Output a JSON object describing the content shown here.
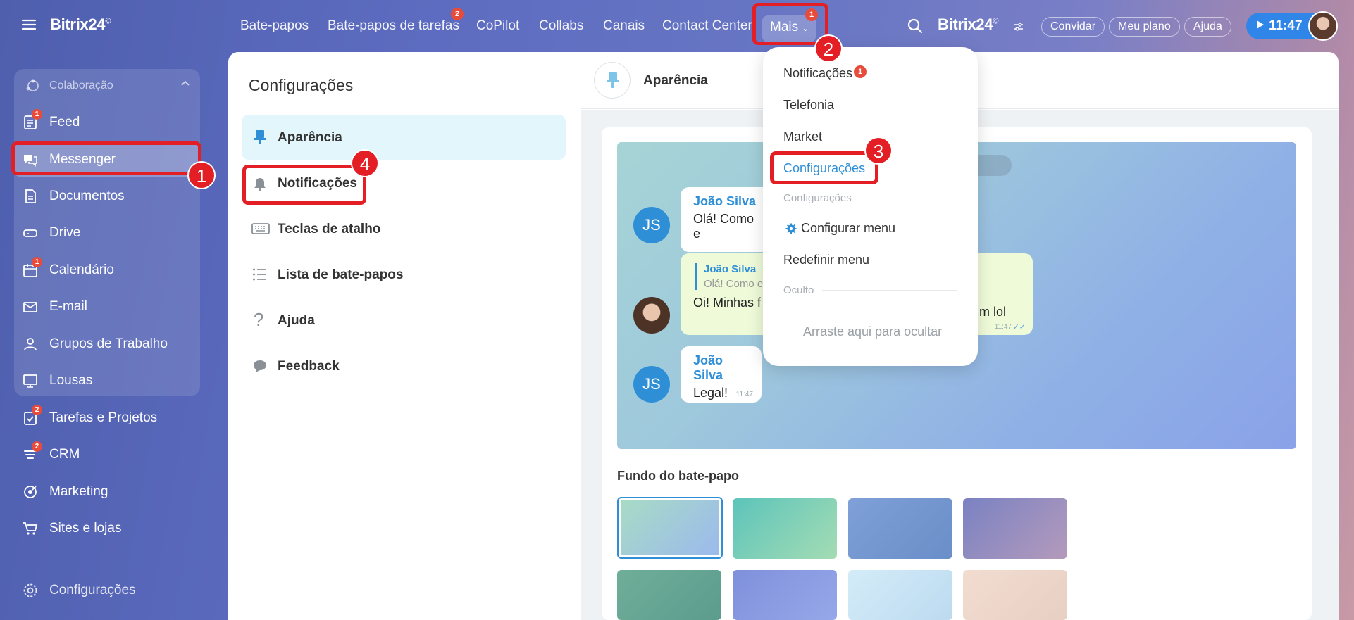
{
  "app": {
    "brand": "Bitrix24",
    "brand_mark": "©",
    "brand_right": "Bitrix24"
  },
  "topnav": {
    "links": [
      "Bate-papos",
      "Bate-papos de tarefas",
      "CoPilot",
      "Collabs",
      "Canais",
      "Contact Center"
    ],
    "tasks_badge": "2",
    "more_label": "Mais",
    "more_badge": "1",
    "invite": "Convidar",
    "plan": "Meu plano",
    "help": "Ajuda",
    "timer": "11:47"
  },
  "sidebar": {
    "group_label": "Colaboração",
    "items": [
      {
        "label": "Feed",
        "badge": "1",
        "icon": "feed-icon"
      },
      {
        "label": "Messenger",
        "badge": "",
        "icon": "messenger-icon"
      },
      {
        "label": "Documentos",
        "badge": "",
        "icon": "document-icon"
      },
      {
        "label": "Drive",
        "badge": "",
        "icon": "drive-icon"
      },
      {
        "label": "Calendário",
        "badge": "1",
        "icon": "calendar-icon"
      },
      {
        "label": "E-mail",
        "badge": "",
        "icon": "mail-icon"
      },
      {
        "label": "Grupos de Trabalho",
        "badge": "",
        "icon": "groups-icon"
      },
      {
        "label": "Lousas",
        "badge": "",
        "icon": "board-icon"
      },
      {
        "label": "Tarefas e Projetos",
        "badge": "2",
        "icon": "tasks-icon"
      },
      {
        "label": "CRM",
        "badge": "2",
        "icon": "crm-icon"
      },
      {
        "label": "Marketing",
        "badge": "",
        "icon": "marketing-icon"
      },
      {
        "label": "Sites e lojas",
        "badge": "",
        "icon": "cart-icon"
      }
    ],
    "settings": "Configurações"
  },
  "settings_panel": {
    "title": "Configurações",
    "items": [
      "Aparência",
      "Notificações",
      "Teclas de atalho",
      "Lista de bate-papos",
      "Ajuda",
      "Feedback"
    ]
  },
  "appearance": {
    "title": "Aparência",
    "messages": [
      {
        "author": "João Silva",
        "text": "Olá! Como e"
      },
      {
        "quote_author": "João Silva",
        "quote_text": "Olá! Como e",
        "text": "Oi! Minhas f",
        "text_end": "m lol",
        "time": "11:47"
      },
      {
        "author": "João Silva",
        "text": "Legal!",
        "time": "11:47"
      }
    ],
    "initials": "JS",
    "background_label": "Fundo do bate-papo"
  },
  "dropdown": {
    "notifications": "Notificações",
    "notifications_badge": "1",
    "telephony": "Telefonia",
    "market": "Market",
    "settings": "Configurações",
    "section_settings": "Configurações",
    "configure_menu": "Configurar menu",
    "reset_menu": "Redefinir menu",
    "section_hidden": "Oculto",
    "drag_hint": "Arraste aqui para ocultar"
  },
  "annotations": [
    "1",
    "2",
    "3",
    "4"
  ],
  "colors": {
    "accent_red": "#e31e24",
    "link_blue": "#2e8fd7",
    "active_bg": "#e3f6fc"
  }
}
